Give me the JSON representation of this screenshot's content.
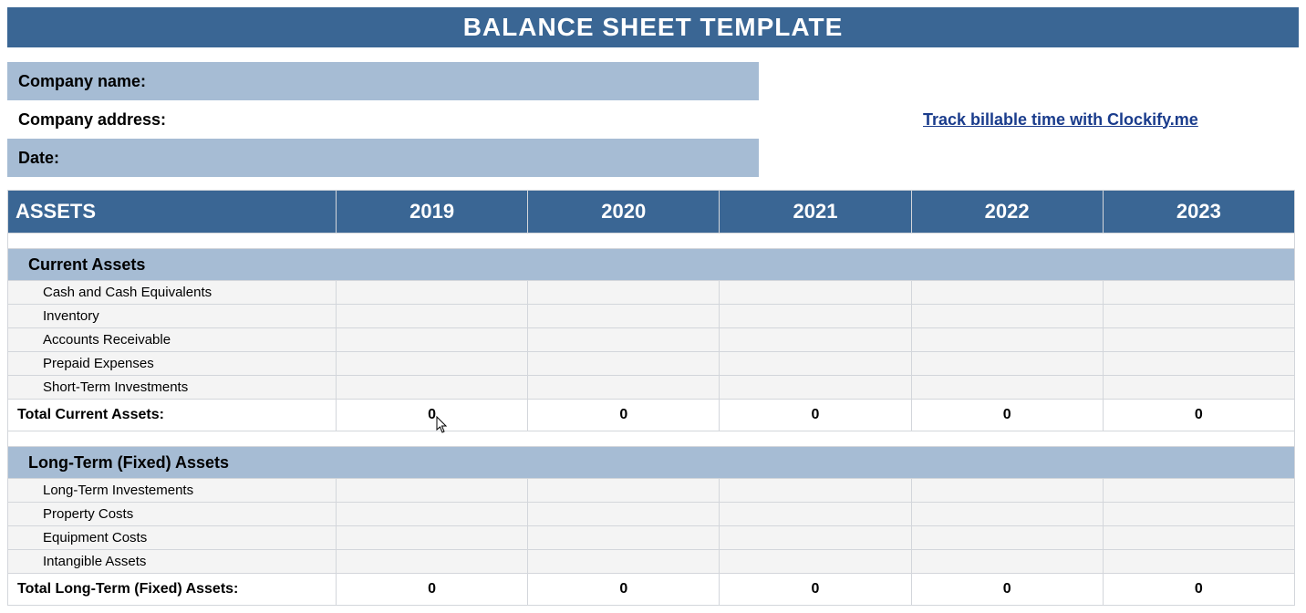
{
  "title": "BALANCE SHEET TEMPLATE",
  "info": {
    "company_name_label": "Company name:",
    "company_address_label": "Company address:",
    "date_label": "Date:",
    "link_text": "Track billable time with Clockify.me"
  },
  "years": [
    "2019",
    "2020",
    "2021",
    "2022",
    "2023"
  ],
  "assets_header": "ASSETS",
  "sections": {
    "current": {
      "title": "Current Assets",
      "items": [
        "Cash and Cash Equivalents",
        "Inventory",
        "Accounts Receivable",
        "Prepaid Expenses",
        "Short-Term Investments"
      ],
      "total_label": "Total Current Assets:",
      "totals": [
        "0",
        "0",
        "0",
        "0",
        "0"
      ]
    },
    "longterm": {
      "title": "Long-Term (Fixed) Assets",
      "items": [
        "Long-Term Investements",
        "Property Costs",
        "Equipment Costs",
        "Intangible Assets"
      ],
      "total_label": "Total Long-Term (Fixed) Assets:",
      "totals": [
        "0",
        "0",
        "0",
        "0",
        "0"
      ]
    }
  }
}
